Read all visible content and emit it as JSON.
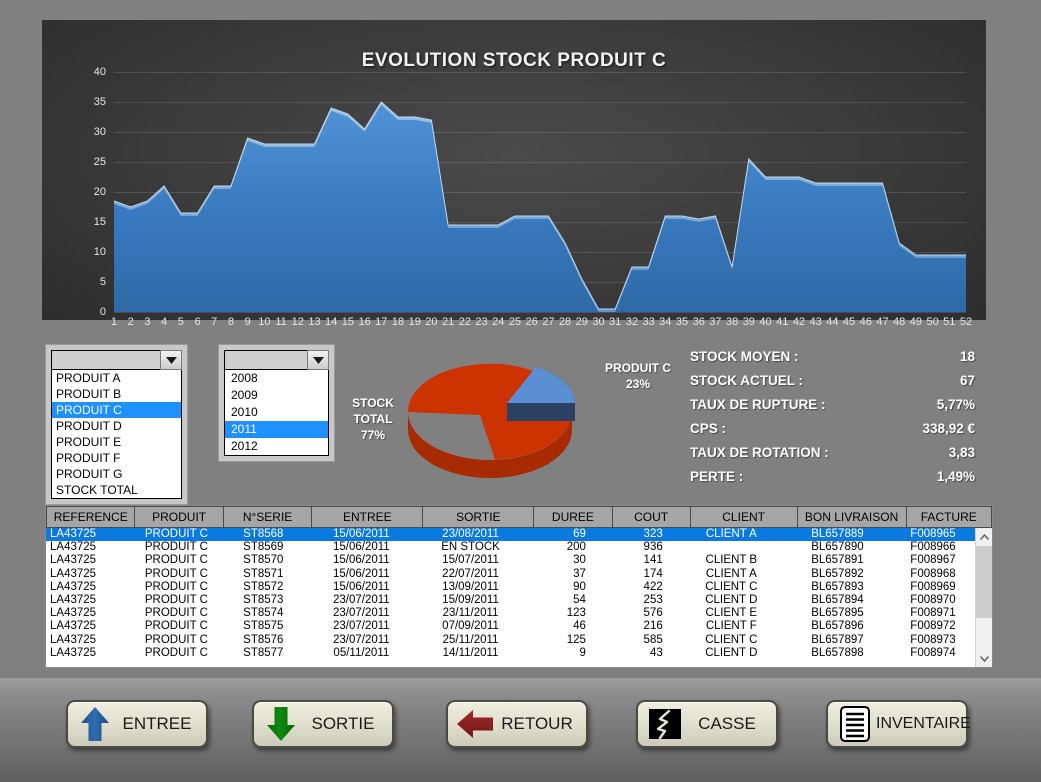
{
  "chart_data": {
    "type": "area",
    "title": "EVOLUTION STOCK PRODUIT C",
    "xlabel": "",
    "ylabel": "",
    "ylim": [
      0,
      40
    ],
    "yticks": [
      0,
      5,
      10,
      15,
      20,
      25,
      30,
      35,
      40
    ],
    "grid": true,
    "legend": "none",
    "categories": [
      1,
      2,
      3,
      4,
      5,
      6,
      7,
      8,
      9,
      10,
      11,
      12,
      13,
      14,
      15,
      16,
      17,
      18,
      19,
      20,
      21,
      22,
      23,
      24,
      25,
      26,
      27,
      28,
      29,
      30,
      31,
      32,
      33,
      34,
      35,
      36,
      37,
      38,
      39,
      40,
      41,
      42,
      43,
      44,
      45,
      46,
      47,
      48,
      49,
      50,
      51,
      52
    ],
    "values": [
      18,
      17,
      18,
      20.5,
      16,
      16,
      20.5,
      20.5,
      28.5,
      27.5,
      27.5,
      27.5,
      27.5,
      33.5,
      32.5,
      30,
      34.5,
      32,
      32,
      31.5,
      14,
      14,
      14,
      14,
      15.5,
      15.5,
      15.5,
      11,
      5,
      0,
      0,
      7,
      7,
      15.5,
      15.5,
      15,
      15.5,
      7,
      25,
      22,
      22,
      22,
      21,
      21,
      21,
      21,
      21,
      11,
      9,
      9,
      9,
      9
    ],
    "series_color": "#3c7fc4",
    "background": "#333333"
  },
  "pie_chart": {
    "type": "pie",
    "title": "",
    "slices": [
      {
        "label": "STOCK TOTAL",
        "value": 77,
        "display": "77%",
        "color": "#cc3300"
      },
      {
        "label": "PRODUIT C",
        "value": 23,
        "display": "23%",
        "color": "#5b8fd4"
      }
    ],
    "stock_total_label": "STOCK",
    "stock_total_label2": "TOTAL",
    "stock_total_pct": "77%",
    "produit_c_label": "PRODUIT C",
    "produit_c_pct": "23%"
  },
  "combo_produit": {
    "name": "produit-selector",
    "value": "",
    "options": [
      "PRODUIT A",
      "PRODUIT B",
      "PRODUIT C",
      "PRODUIT D",
      "PRODUIT E",
      "PRODUIT F",
      "PRODUIT G",
      "STOCK TOTAL"
    ],
    "selected_index": 2,
    "selected": "PRODUIT C"
  },
  "combo_annee": {
    "name": "annee-selector",
    "value": "",
    "options": [
      "2008",
      "2009",
      "2010",
      "2011",
      "2012"
    ],
    "selected_index": 3,
    "selected": "2011"
  },
  "stats": [
    {
      "label": "STOCK MOYEN :",
      "value": "18"
    },
    {
      "label": "STOCK ACTUEL :",
      "value": "67"
    },
    {
      "label": "TAUX DE RUPTURE :",
      "value": "5,77%"
    },
    {
      "label": "CPS :",
      "value": "338,92 €"
    },
    {
      "label": "TAUX DE ROTATION :",
      "value": "3,83"
    },
    {
      "label": "PERTE :",
      "value": "1,49%"
    }
  ],
  "table": {
    "columns": [
      "REFERENCE",
      "PRODUIT",
      "N°SERIE",
      "ENTREE",
      "SORTIE",
      "DUREE",
      "COUT",
      "CLIENT",
      "BON LIVRAISON",
      "FACTURE"
    ],
    "selected_row": 0,
    "rows": [
      [
        "LA43725",
        "PRODUIT C",
        "ST8568",
        "15/06/2011",
        "23/08/2011",
        "69",
        "323",
        "CLIENT A",
        "BL657889",
        "F008965"
      ],
      [
        "LA43725",
        "PRODUIT C",
        "ST8569",
        "15/06/2011",
        "EN STOCK",
        "200",
        "936",
        "",
        "BL657890",
        "F008966"
      ],
      [
        "LA43725",
        "PRODUIT C",
        "ST8570",
        "15/06/2011",
        "15/07/2011",
        "30",
        "141",
        "CLIENT B",
        "BL657891",
        "F008967"
      ],
      [
        "LA43725",
        "PRODUIT C",
        "ST8571",
        "15/06/2011",
        "22/07/2011",
        "37",
        "174",
        "CLIENT A",
        "BL657892",
        "F008968"
      ],
      [
        "LA43725",
        "PRODUIT C",
        "ST8572",
        "15/06/2011",
        "13/09/2011",
        "90",
        "422",
        "CLIENT C",
        "BL657893",
        "F008969"
      ],
      [
        "LA43725",
        "PRODUIT C",
        "ST8573",
        "23/07/2011",
        "15/09/2011",
        "54",
        "253",
        "CLIENT D",
        "BL657894",
        "F008970"
      ],
      [
        "LA43725",
        "PRODUIT C",
        "ST8574",
        "23/07/2011",
        "23/11/2011",
        "123",
        "576",
        "CLIENT E",
        "BL657895",
        "F008971"
      ],
      [
        "LA43725",
        "PRODUIT C",
        "ST8575",
        "23/07/2011",
        "07/09/2011",
        "46",
        "216",
        "CLIENT F",
        "BL657896",
        "F008972"
      ],
      [
        "LA43725",
        "PRODUIT C",
        "ST8576",
        "23/07/2011",
        "25/11/2011",
        "125",
        "585",
        "CLIENT C",
        "BL657897",
        "F008973"
      ],
      [
        "LA43725",
        "PRODUIT C",
        "ST8577",
        "05/11/2011",
        "14/11/2011",
        "9",
        "43",
        "CLIENT D",
        "BL657898",
        "F008974"
      ]
    ]
  },
  "buttons": [
    {
      "id": "entree",
      "label": "ENTREE",
      "icon": "arrow-up-icon",
      "color": "#2c5f9e"
    },
    {
      "id": "sortie",
      "label": "SORTIE",
      "icon": "arrow-down-icon",
      "color": "#0a7a0a"
    },
    {
      "id": "retour",
      "label": "RETOUR",
      "icon": "arrow-left-icon",
      "color": "#8c2222"
    },
    {
      "id": "casse",
      "label": "CASSE",
      "icon": "broken-glass-icon",
      "color": "#000000"
    },
    {
      "id": "inventaire",
      "label": "INVENTAIRE",
      "icon": "document-lines-icon",
      "color": "#000000"
    }
  ]
}
